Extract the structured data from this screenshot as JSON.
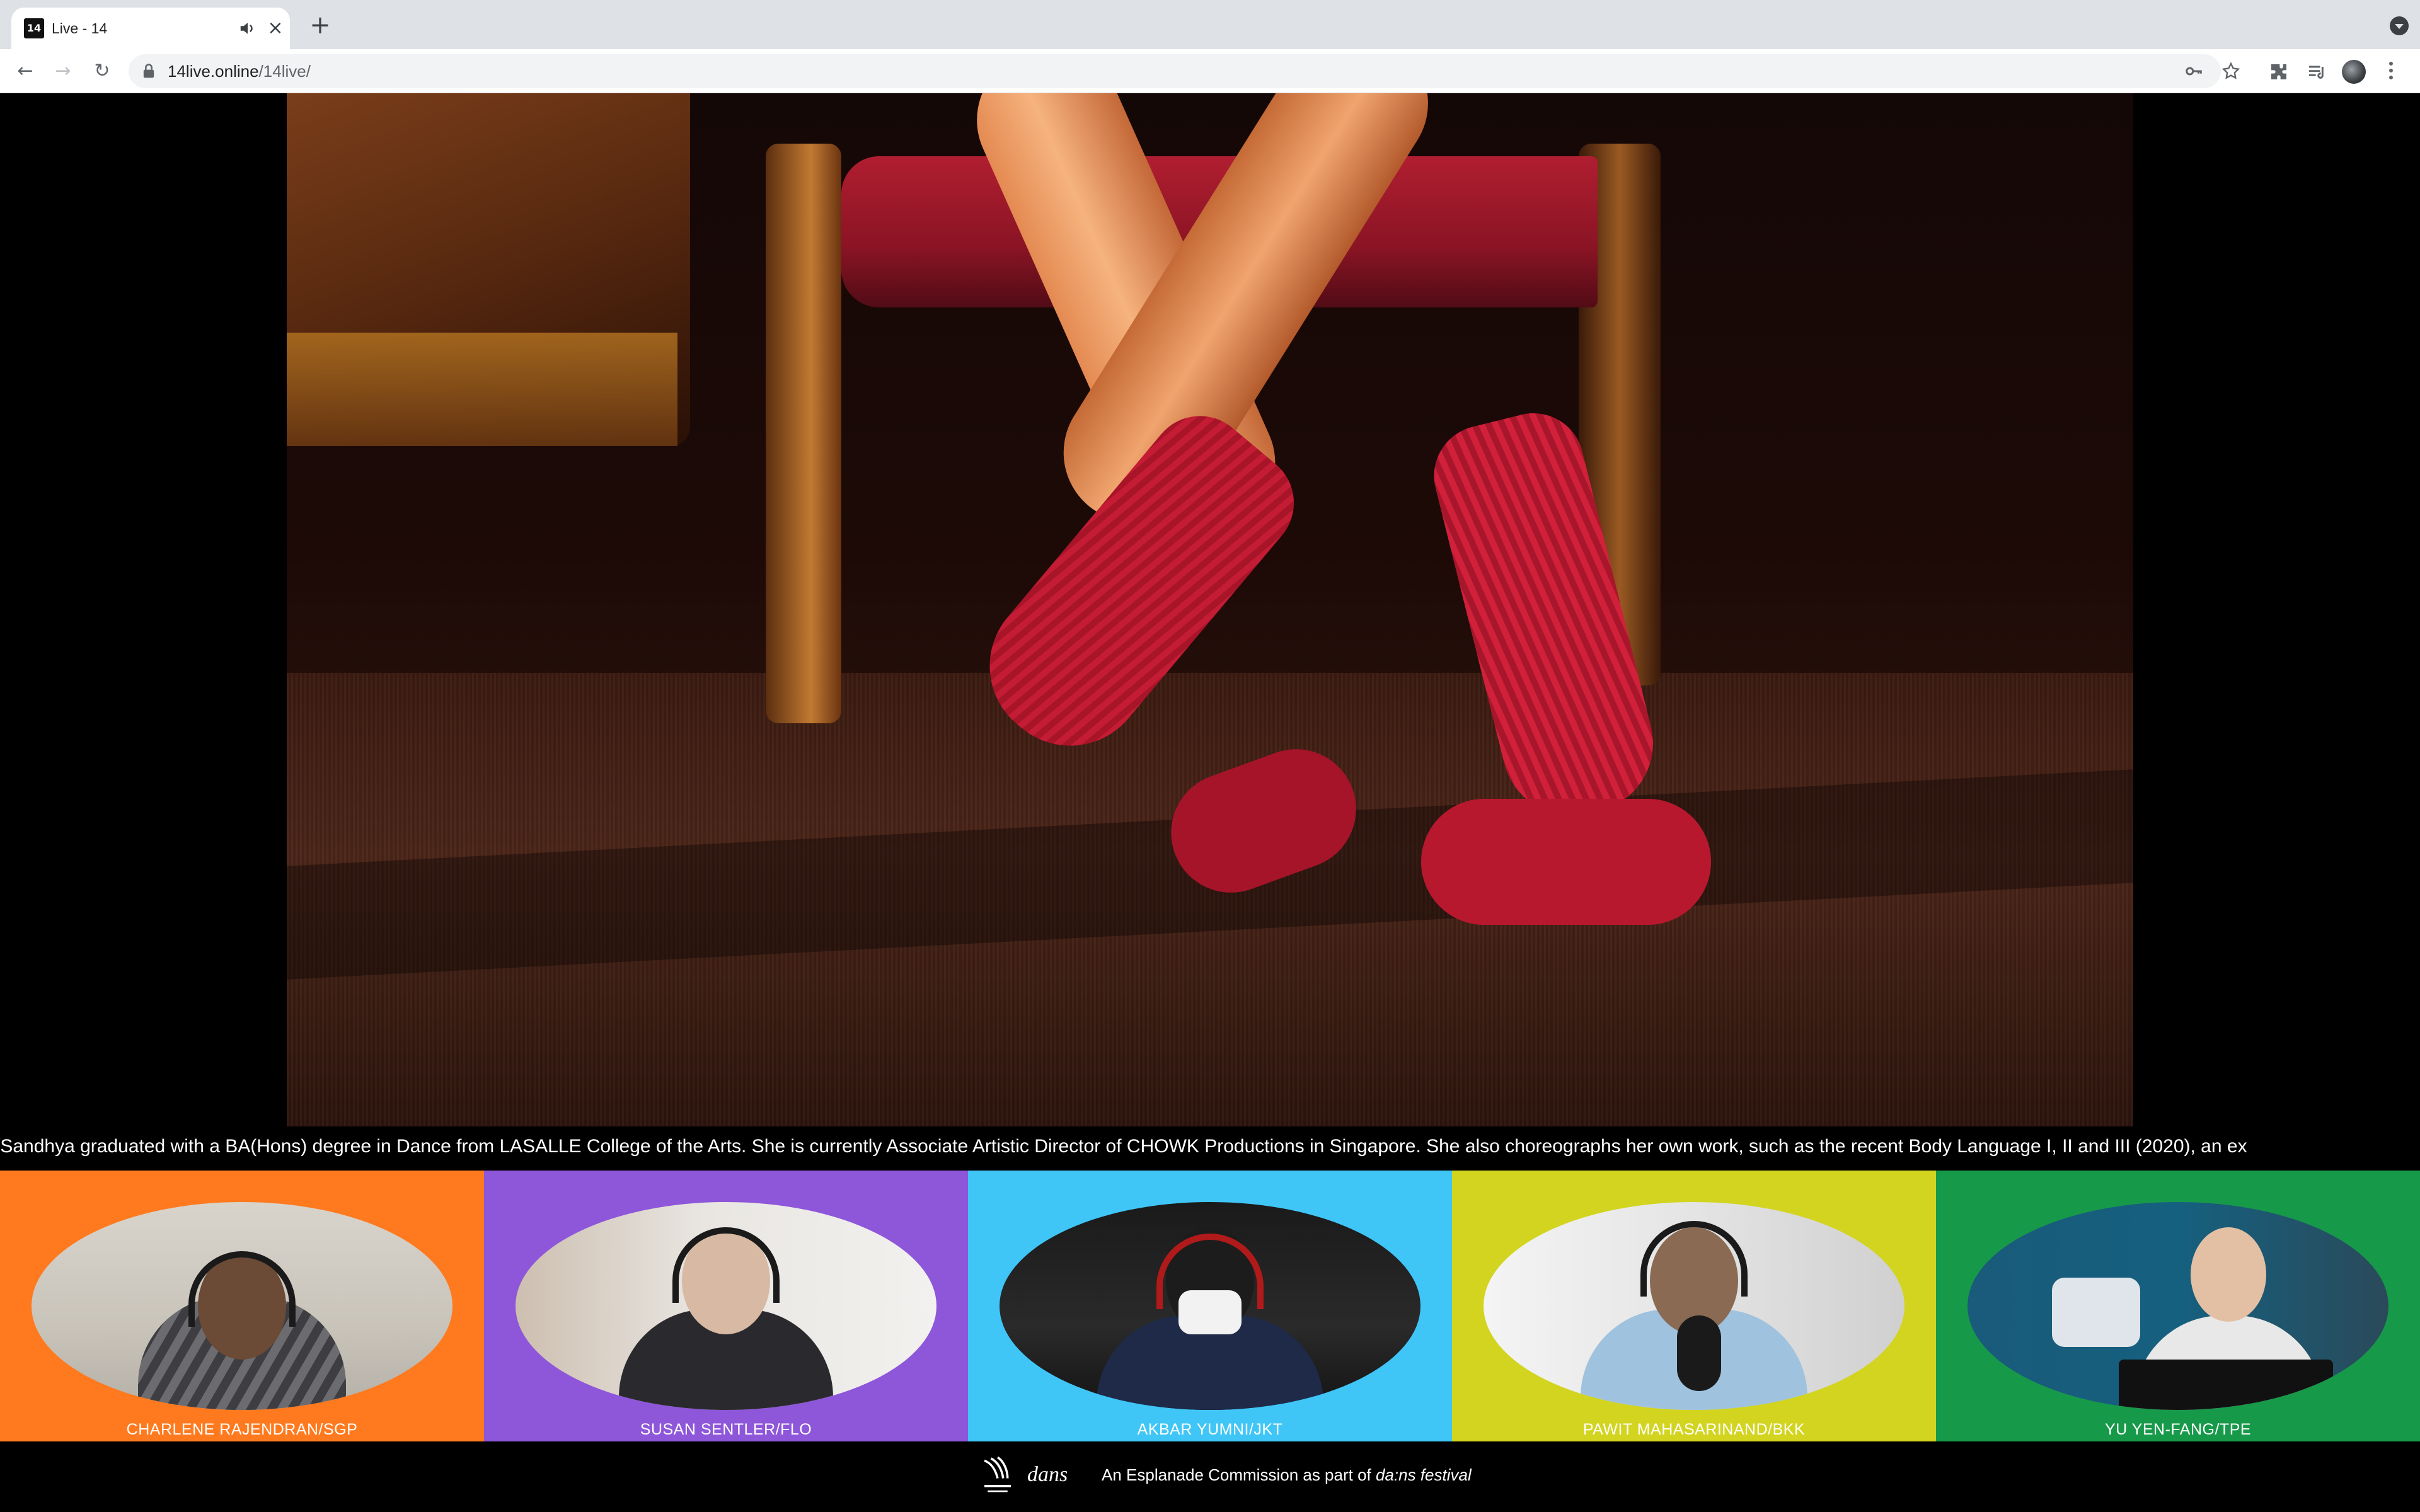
{
  "browser": {
    "tab": {
      "title": "Live - 14",
      "favicon_text": "14"
    },
    "icons": {
      "audio": "speaker-icon",
      "close": "close-icon",
      "new_tab": "plus-icon",
      "tab_search": "chevron-down-icon",
      "back": "arrow-left-icon",
      "forward": "arrow-right-icon",
      "reload": "reload-icon",
      "lock": "lock-icon",
      "key": "key-icon",
      "star": "star-icon",
      "extensions": "puzzle-icon",
      "media": "media-queue-icon",
      "menu": "kebab-icon"
    },
    "address": {
      "host": "14live.online",
      "path": "/14live/"
    }
  },
  "page": {
    "ticker": "/Sandhya graduated with a BA(Hons) degree in Dance from LASALLE College of the Arts. She is currently Associate Artistic Director of CHOWK Productions in Singapore. She also choreographs her own work, such as the recent Body Language I, II and III (2020), an ex",
    "participants": [
      {
        "name": "CHARLENE RAJENDRAN/SGP",
        "color": "#ff7a1f"
      },
      {
        "name": "SUSAN SENTLER/FLO",
        "color": "#8e56d9"
      },
      {
        "name": "AKBAR YUMNI/JKT",
        "color": "#3fc6f7"
      },
      {
        "name": "PAWIT MAHASARINAND/BKK",
        "color": "#d2d420"
      },
      {
        "name": "YU YEN-FANG/TPE",
        "color": "#17994a"
      }
    ],
    "footer": {
      "logo_text": "dans",
      "commission_prefix": "An Esplanade Commission as part of ",
      "festival": "da:ns festival"
    }
  }
}
